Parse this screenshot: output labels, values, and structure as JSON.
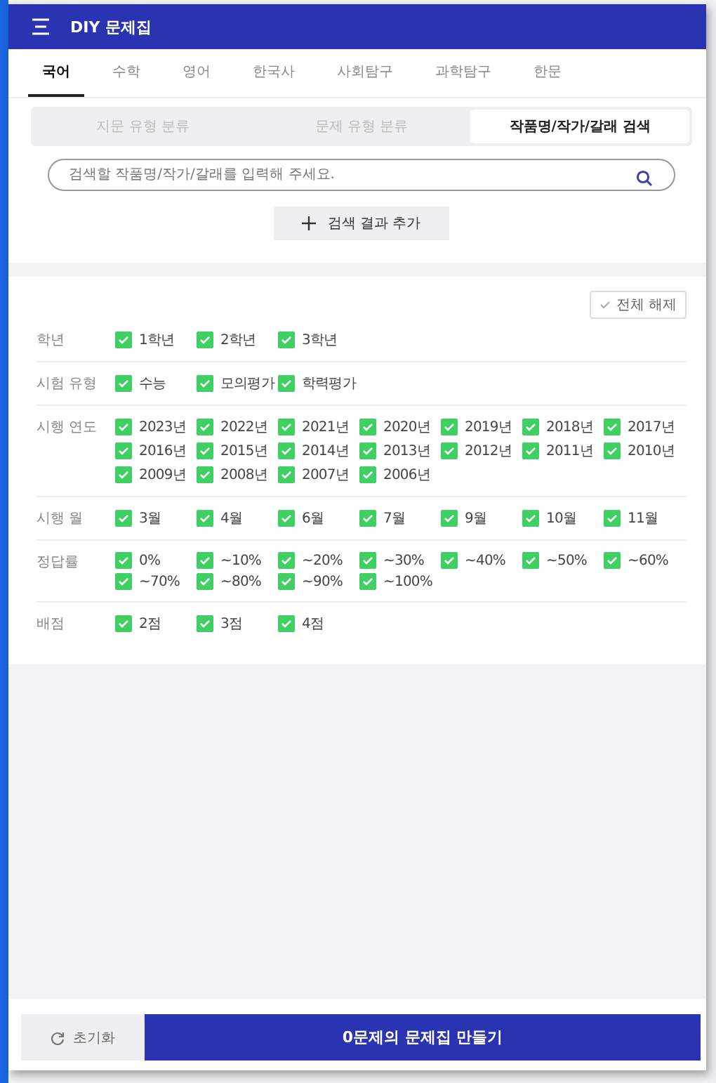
{
  "header": {
    "title": "DIY 문제집"
  },
  "tabs": [
    {
      "label": "국어",
      "selected": true
    },
    {
      "label": "수학",
      "selected": false
    },
    {
      "label": "영어",
      "selected": false
    },
    {
      "label": "한국사",
      "selected": false
    },
    {
      "label": "사회탐구",
      "selected": false
    },
    {
      "label": "과학탐구",
      "selected": false
    },
    {
      "label": "한문",
      "selected": false
    }
  ],
  "subtabs": [
    {
      "label": "지문 유형 분류",
      "selected": false
    },
    {
      "label": "문제 유형 분류",
      "selected": false
    },
    {
      "label": "작품명/작가/갈래 검색",
      "selected": true
    }
  ],
  "search": {
    "placeholder": "검색할 작품명/작가/갈래를 입력해 주세요."
  },
  "add_button": "검색 결과 추가",
  "clear_all_button": "전체 해제",
  "filters": [
    {
      "label": "학년",
      "options": [
        {
          "label": "1학년",
          "checked": true
        },
        {
          "label": "2학년",
          "checked": true
        },
        {
          "label": "3학년",
          "checked": true
        }
      ]
    },
    {
      "label": "시험 유형",
      "options": [
        {
          "label": "수능",
          "checked": true
        },
        {
          "label": "모의평가",
          "checked": true
        },
        {
          "label": "학력평가",
          "checked": true
        }
      ]
    },
    {
      "label": "시행 연도",
      "options": [
        {
          "label": "2023년",
          "checked": true
        },
        {
          "label": "2022년",
          "checked": true
        },
        {
          "label": "2021년",
          "checked": true
        },
        {
          "label": "2020년",
          "checked": true
        },
        {
          "label": "2019년",
          "checked": true
        },
        {
          "label": "2018년",
          "checked": true
        },
        {
          "label": "2017년",
          "checked": true
        },
        {
          "label": "2016년",
          "checked": true
        },
        {
          "label": "2015년",
          "checked": true
        },
        {
          "label": "2014년",
          "checked": true
        },
        {
          "label": "2013년",
          "checked": true
        },
        {
          "label": "2012년",
          "checked": true
        },
        {
          "label": "2011년",
          "checked": true
        },
        {
          "label": "2010년",
          "checked": true
        },
        {
          "label": "2009년",
          "checked": true
        },
        {
          "label": "2008년",
          "checked": true
        },
        {
          "label": "2007년",
          "checked": true
        },
        {
          "label": "2006년",
          "checked": true
        }
      ]
    },
    {
      "label": "시행 월",
      "options": [
        {
          "label": "3월",
          "checked": true
        },
        {
          "label": "4월",
          "checked": true
        },
        {
          "label": "6월",
          "checked": true
        },
        {
          "label": "7월",
          "checked": true
        },
        {
          "label": "9월",
          "checked": true
        },
        {
          "label": "10월",
          "checked": true
        },
        {
          "label": "11월",
          "checked": true
        }
      ]
    },
    {
      "label": "정답률",
      "options": [
        {
          "label": "0%",
          "checked": true
        },
        {
          "label": "~10%",
          "checked": true
        },
        {
          "label": "~20%",
          "checked": true
        },
        {
          "label": "~30%",
          "checked": true
        },
        {
          "label": "~40%",
          "checked": true
        },
        {
          "label": "~50%",
          "checked": true
        },
        {
          "label": "~60%",
          "checked": true
        },
        {
          "label": "~70%",
          "checked": true
        },
        {
          "label": "~80%",
          "checked": true
        },
        {
          "label": "~90%",
          "checked": true
        },
        {
          "label": "~100%",
          "checked": true
        }
      ]
    },
    {
      "label": "배점",
      "options": [
        {
          "label": "2점",
          "checked": true
        },
        {
          "label": "3점",
          "checked": true
        },
        {
          "label": "4점",
          "checked": true
        }
      ]
    }
  ],
  "footer": {
    "reset_button": "초기화",
    "create_button": "0문제의 문제집 만들기"
  }
}
